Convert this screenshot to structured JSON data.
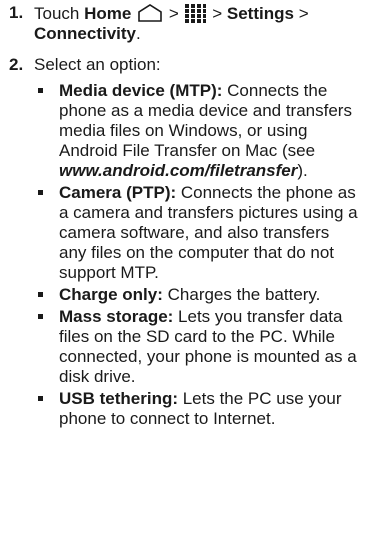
{
  "steps": [
    {
      "number": "1.",
      "text_touch": "Touch",
      "home": "Home",
      "sep1": ">",
      "sep2": ">",
      "settings": "Settings",
      "sep3": ">",
      "connectivity": "Connectivity",
      "period": ".",
      "icons": [
        "home-icon",
        "apps-grid-icon"
      ]
    },
    {
      "number": "2.",
      "text": "Select an option:"
    }
  ],
  "options": [
    {
      "title": "Media device (MTP):",
      "desc": " Connects the phone as a media device and transfers media files on Windows, or using Android File Transfer on Mac (see ",
      "link": "www.android.com/filetransfer",
      "tail": ")."
    },
    {
      "title": "Camera (PTP):",
      "desc": " Connects the phone as a camera and transfers pictures using a camera software, and also transfers any files on the computer that do not support MTP."
    },
    {
      "title": "Charge only:",
      "desc": " Charges the battery."
    },
    {
      "title": "Mass storage:",
      "desc": " Lets you transfer data files on the SD card to the PC. While connected, your phone is mounted as a disk drive."
    },
    {
      "title": "USB tethering:",
      "desc": " Lets the PC use your phone to connect to Internet."
    }
  ]
}
